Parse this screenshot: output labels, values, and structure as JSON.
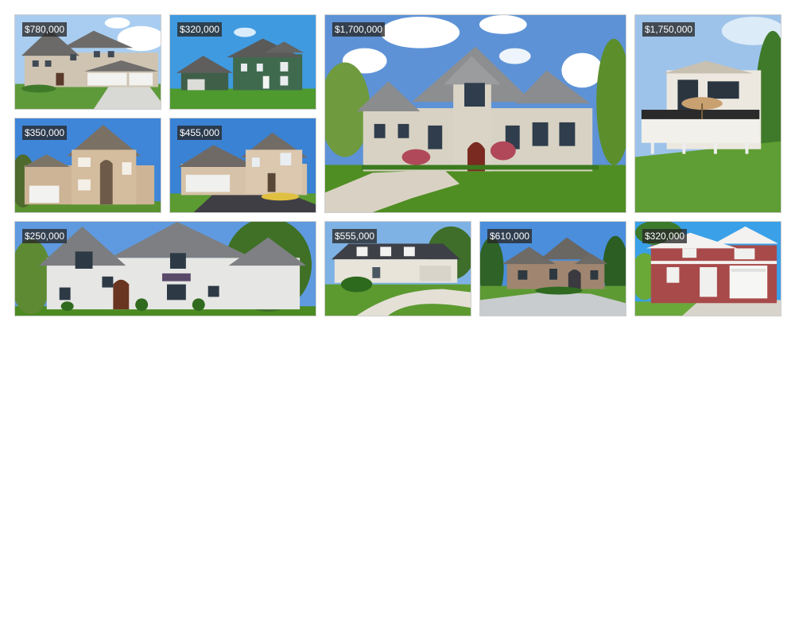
{
  "listings": [
    {
      "price": "$780,000"
    },
    {
      "price": "$320,000"
    },
    {
      "price": "$1,700,000"
    },
    {
      "price": "$1,750,000"
    },
    {
      "price": "$350,000"
    },
    {
      "price": "$455,000"
    },
    {
      "price": "$250,000"
    },
    {
      "price": "$555,000"
    },
    {
      "price": "$610,000"
    },
    {
      "price": "$320,000"
    }
  ]
}
